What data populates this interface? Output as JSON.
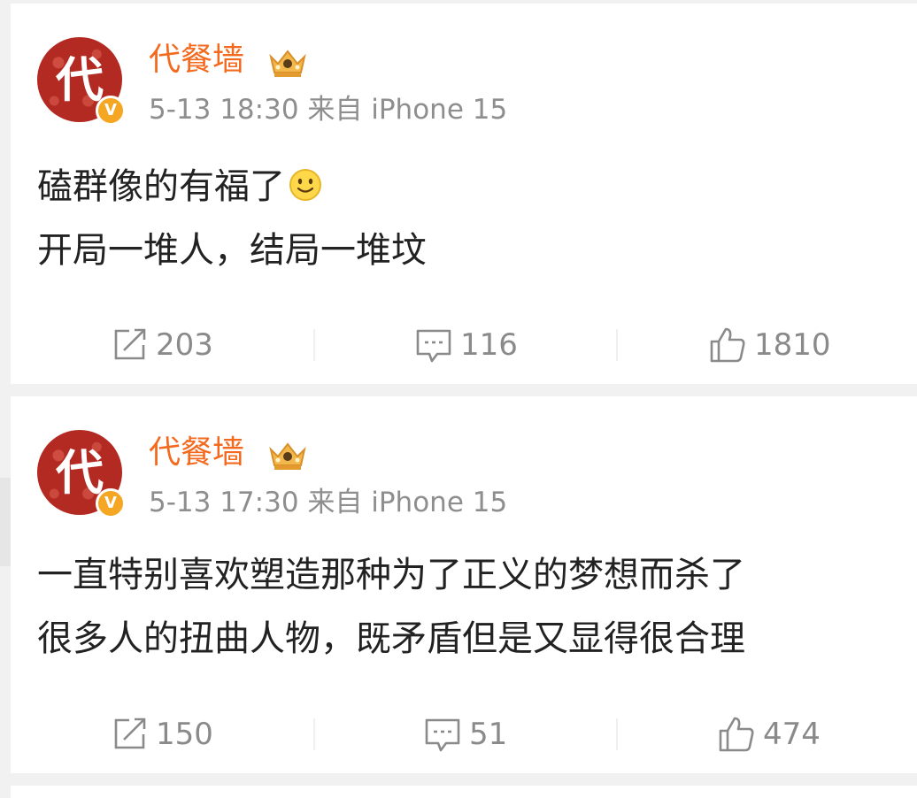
{
  "colors": {
    "username": "#f36a1f",
    "meta": "#8e8e8e",
    "content": "#222222",
    "action": "#8a8a8a",
    "avatar_bg": "#b32a22",
    "verified_badge": "#f5a623"
  },
  "posts": [
    {
      "avatar_char": "代",
      "verified_mark": "V",
      "username": "代餐墙",
      "badge_icon": "crown-icon",
      "meta": "5-13 18:30 来自 iPhone 15",
      "content_lines": [
        "磕群像的有福了",
        "开局一堆人，结局一堆坟"
      ],
      "emoji": "smile-emoji",
      "reposts": "203",
      "comments": "116",
      "likes": "1810"
    },
    {
      "avatar_char": "代",
      "verified_mark": "V",
      "username": "代餐墙",
      "badge_icon": "crown-icon",
      "meta": "5-13 17:30 来自 iPhone 15",
      "content_lines": [
        "一直特别喜欢塑造那种为了正义的梦想而杀了",
        "很多人的扭曲人物，既矛盾但是又显得很合理"
      ],
      "reposts": "150",
      "comments": "51",
      "likes": "474"
    }
  ]
}
